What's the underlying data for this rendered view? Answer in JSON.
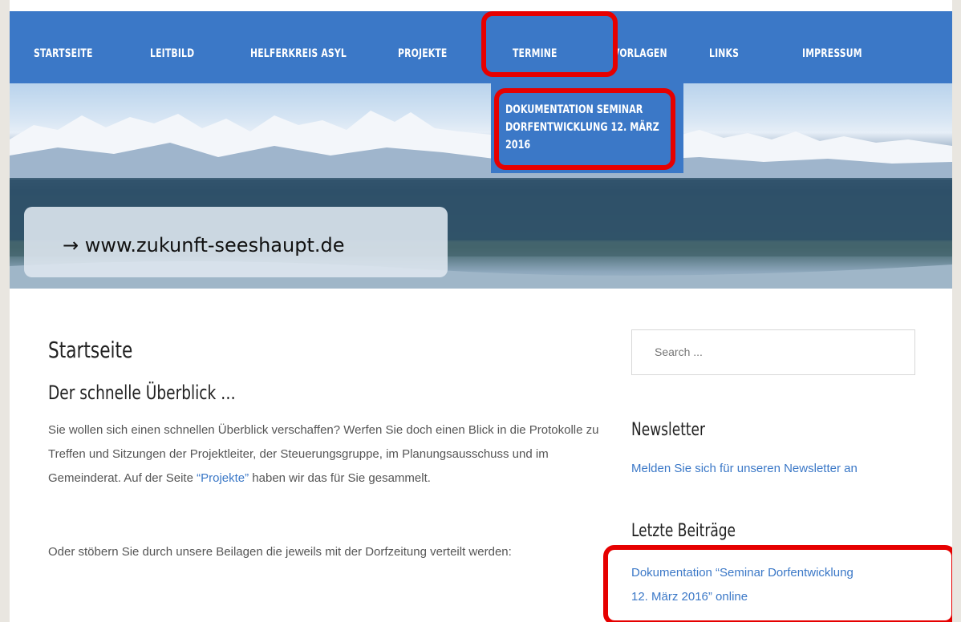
{
  "nav": {
    "items": [
      {
        "label": "STARTSEITE"
      },
      {
        "label": "LEITBILD"
      },
      {
        "label": "HELFERKREIS ASYL"
      },
      {
        "label": "PROJEKTE"
      },
      {
        "label": "TERMINE"
      },
      {
        "label": "VORLAGEN"
      },
      {
        "label": "LINKS"
      },
      {
        "label": "IMPRESSUM"
      }
    ],
    "dropdown": {
      "line1": "DOKUMENTATION SEMINAR",
      "line2": "DORFENTWICKLUNG 12. MÄRZ",
      "line3": "2016"
    }
  },
  "hero": {
    "url_text": "→ www.zukunft-seeshaupt.de"
  },
  "main": {
    "page_title": "Startseite",
    "subtitle": "Der schnelle Überblick …",
    "para1_before": "Sie wollen sich einen schnellen Überblick verschaffen? Werfen Sie doch einen Blick in die Protokolle zu Treffen und Sitzungen der Projektleiter, der Steuerungsgruppe, im Planungsausschuss und im Gemeinderat. Auf der Seite ",
    "para1_link": "“Projekte”",
    "para1_after": " haben wir das für Sie gesammelt.",
    "para2": "Oder stöbern Sie durch unsere Beilagen die jeweils mit der Dorfzeitung verteilt werden:"
  },
  "sidebar": {
    "search_placeholder": "Search ...",
    "newsletter_heading": "Newsletter",
    "newsletter_link": "Melden Sie sich für unseren Newsletter an",
    "recent_heading": "Letzte Beiträge",
    "recent_post_line1": "Dokumentation “Seminar Dorfentwicklung",
    "recent_post_line2": "12. März 2016” online"
  },
  "colors": {
    "nav_bg": "#3b78c7",
    "link": "#3b78c7",
    "highlight": "#e60000"
  }
}
